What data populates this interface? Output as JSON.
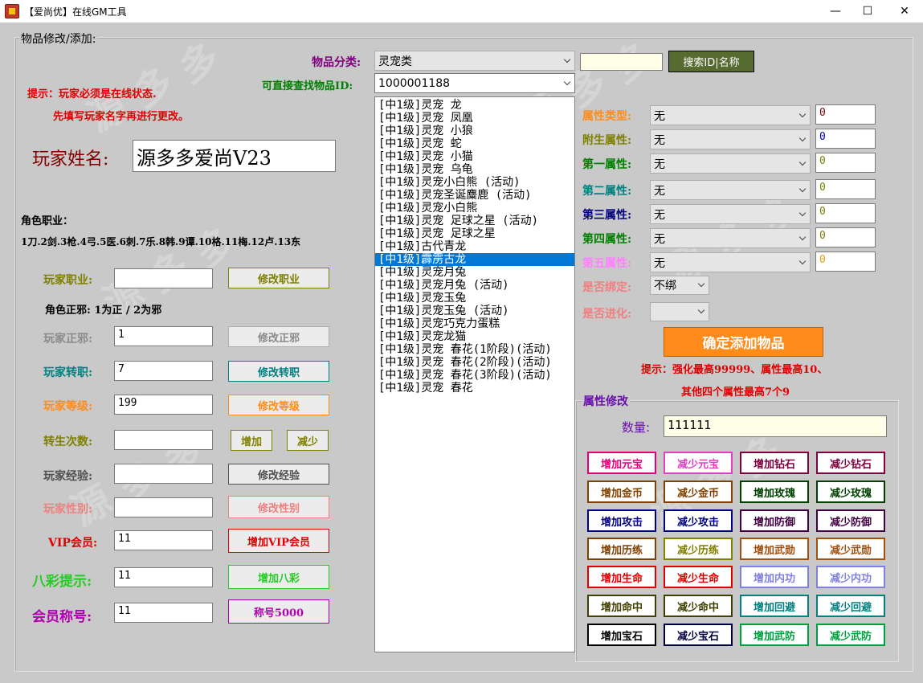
{
  "window": {
    "title": "【爱尚优】在线GM工具",
    "minimize": "—",
    "maximize": "☐",
    "close": "✕"
  },
  "group_title": "物品修改/添加:",
  "hint": {
    "line1": "提示：玩家必须是在线状态.",
    "line2": "先填写玩家名字再进行更改。"
  },
  "player_name": {
    "label": "玩家姓名:",
    "value": "源多多爱尚V23"
  },
  "role": {
    "title": "角色职业：",
    "list": "1刀.2剑.3枪.4弓.5医.6刺.7乐.8韩.9谭.10格.11梅.12卢.13东"
  },
  "align_hint": "角色正邪: 1为正 / 2为邪",
  "rows": [
    {
      "label": "玩家职业:",
      "value": "",
      "button": "修改职业",
      "color": "#808000"
    },
    {
      "label": "玩家正邪:",
      "value": "1",
      "button": "修改正邪",
      "color": "#8a8a8a"
    },
    {
      "label": "玩家转职:",
      "value": "7",
      "button": "修改转职",
      "color": "#008080"
    },
    {
      "label": "玩家等级:",
      "value": "199",
      "button": "修改等级",
      "color": "#ff8c1a"
    },
    {
      "label": "转生次数:",
      "value": "",
      "button_add": "增加",
      "button_sub": "减少",
      "color": "#808000"
    },
    {
      "label": "玩家经验:",
      "value": "",
      "button": "修改经验",
      "color": "#505050"
    },
    {
      "label": "玩家性别:",
      "value": "",
      "button": "修改性别",
      "color": "#f08080"
    },
    {
      "label": "VIP会员:",
      "value": "11",
      "button": "增加VIP会员",
      "color": "#e00000"
    },
    {
      "label": "八彩提示:",
      "value": "11",
      "button": "增加八彩",
      "color": "#22cc22"
    },
    {
      "label": "会员称号:",
      "value": "11",
      "button": "称号5000",
      "color": "#b000b0"
    }
  ],
  "category": {
    "label": "物品分类:",
    "value": "灵宠类"
  },
  "item_id": {
    "label": "可直接查找物品ID:",
    "value": "1000001188"
  },
  "search": {
    "value": "",
    "button": "搜索ID|名称"
  },
  "items": [
    "[中1级]灵宠 龙",
    "[中1级]灵宠 凤凰",
    "[中1级]灵宠 小狼",
    "[中1级]灵宠 蛇",
    "[中1级]灵宠 小猫",
    "[中1级]灵宠 乌龟",
    "[中1级]灵宠小白熊 (活动)",
    "[中1级]灵宠圣诞麋鹿 (活动)",
    "[中1级]灵宠小白熊",
    "[中1级]灵宠 足球之星 (活动)",
    "[中1级]灵宠 足球之星",
    "[中1级]古代青龙",
    "[中1级]霹雳古龙",
    "[中1级]灵宠月兔",
    "[中1级]灵宠月兔 (活动)",
    "[中1级]灵宠玉兔",
    "[中1级]灵宠玉兔 (活动)",
    "[中1级]灵宠巧克力蛋糕",
    "[中1级]灵宠龙猫",
    "[中1级]灵宠 春花(1阶段)(活动)",
    "[中1级]灵宠 春花(2阶段)(活动)",
    "[中1级]灵宠 春花(3阶段)(活动)",
    "[中1级]灵宠 春花"
  ],
  "selected_index": 12,
  "attributes": [
    {
      "label": "属性类型:",
      "value": "无",
      "num": "0",
      "color": "#ff8c1a",
      "num_color": "#800000"
    },
    {
      "label": "附生属性:",
      "value": "无",
      "num": "0",
      "color": "#808000",
      "num_color": "#0000c0"
    },
    {
      "label": "第一属性:",
      "value": "无",
      "num": "0",
      "color": "#008000",
      "num_color": "#808000"
    },
    {
      "label": "第二属性:",
      "value": "无",
      "num": "0",
      "color": "#008080",
      "num_color": "#808000"
    },
    {
      "label": "第三属性:",
      "value": "无",
      "num": "0",
      "color": "#000080",
      "num_color": "#808000"
    },
    {
      "label": "第四属性:",
      "value": "无",
      "num": "0",
      "color": "#008000",
      "num_color": "#808000"
    },
    {
      "label": "第五属性:",
      "value": "无",
      "num": "0",
      "color": "#ff80ff",
      "num_color": "#e0a000"
    }
  ],
  "bind": {
    "label": "是否绑定:",
    "value": "不绑",
    "color": "#f08080"
  },
  "evolve": {
    "label": "是否进化:",
    "value": "",
    "color": "#f08080"
  },
  "confirm_button": "确定添加物品",
  "tip": {
    "line1": "提示：强化最高99999、属性最高10、",
    "line2": "其他四个属性最高7个9"
  },
  "attr_mod": {
    "title": "属性修改",
    "qty_label": "数量:",
    "qty_value": "111111"
  },
  "grid_buttons": [
    {
      "label": "增加元宝",
      "color": "#e0007a"
    },
    {
      "label": "减少元宝",
      "color": "#e040c0"
    },
    {
      "label": "增加钻石",
      "color": "#800040"
    },
    {
      "label": "减少钻石",
      "color": "#800040"
    },
    {
      "label": "增加金币",
      "color": "#804000"
    },
    {
      "label": "减少金币",
      "color": "#804000"
    },
    {
      "label": "增加玫瑰",
      "color": "#004000"
    },
    {
      "label": "减少玫瑰",
      "color": "#004000"
    },
    {
      "label": "增加攻击",
      "color": "#000080"
    },
    {
      "label": "减少攻击",
      "color": "#000080"
    },
    {
      "label": "增加防御",
      "color": "#400040"
    },
    {
      "label": "减少防御",
      "color": "#400040"
    },
    {
      "label": "增加历练",
      "color": "#804000"
    },
    {
      "label": "减少历练",
      "color": "#808000"
    },
    {
      "label": "增加武勋",
      "color": "#a05010"
    },
    {
      "label": "减少武勋",
      "color": "#a05010"
    },
    {
      "label": "增加生命",
      "color": "#e00000"
    },
    {
      "label": "减少生命",
      "color": "#e00000"
    },
    {
      "label": "增加内功",
      "color": "#8080e0"
    },
    {
      "label": "减少内功",
      "color": "#8080e0"
    },
    {
      "label": "增加命中",
      "color": "#404000"
    },
    {
      "label": "减少命中",
      "color": "#404000"
    },
    {
      "label": "增加回避",
      "color": "#008080"
    },
    {
      "label": "减少回避",
      "color": "#008080"
    },
    {
      "label": "增加宝石",
      "color": "#000000"
    },
    {
      "label": "减少宝石",
      "color": "#000040"
    },
    {
      "label": "增加武防",
      "color": "#00a040"
    },
    {
      "label": "减少武防",
      "color": "#00a040"
    }
  ]
}
